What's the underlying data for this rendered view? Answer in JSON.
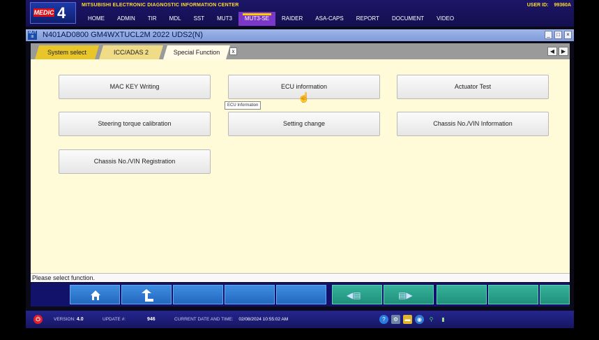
{
  "app": {
    "logo_text": "MEDIC",
    "logo_number": "4",
    "title": "MITSUBISHI ELECTRONIC DIAGNOSTIC INFORMATION CENTER",
    "user_id_label": "USER ID:",
    "user_id_value": "99360A"
  },
  "nav": {
    "items": [
      "HOME",
      "ADMIN",
      "TIR",
      "MDL",
      "SST",
      "MUT3",
      "MUT3-SE",
      "RAIDER",
      "ASA-CAPS",
      "REPORT",
      "DOCUMENT",
      "VIDEO"
    ],
    "active": "MUT3-SE"
  },
  "window": {
    "title": "N401AD0800  GM4WXTUCL2M 2022   UDS2(N)",
    "icon_text": "MUT III"
  },
  "tabs": {
    "items": [
      "System select",
      "ICC/ADAS 2",
      "Special Function"
    ],
    "close_label": "x",
    "prev_label": "◀",
    "next_label": "▶"
  },
  "functions": {
    "buttons": [
      "MAC KEY Writing",
      "ECU information",
      "Actuator Test",
      "Steering torque calibration",
      "Setting change",
      "Chassis No./VIN Information",
      "Chassis No./VIN Registration"
    ],
    "tooltip": "ECU Information"
  },
  "status": {
    "message": "Please select function."
  },
  "footer": {
    "version_label": "VERSION:",
    "version_value": "4.0",
    "update_label": "UPDATE #:",
    "update_value": "946",
    "datetime_label": "CURRENT DATE AND TIME:",
    "datetime_value": "02/08/2024 10:55:02 AM"
  },
  "colors": {
    "nav_active": "#7a37c8",
    "tab_system": "#e8c62a",
    "content_bg": "#fffbd8",
    "toolbar_button": "#2f7ad2",
    "toolbar_button_green": "#2aa38b"
  }
}
